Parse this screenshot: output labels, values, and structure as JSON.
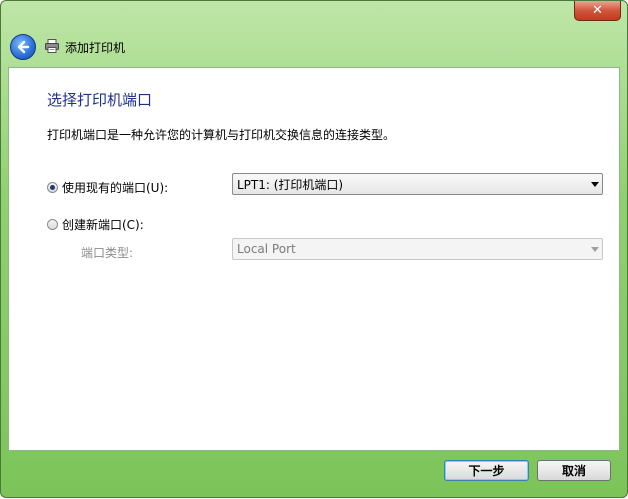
{
  "window": {
    "title": "添加打印机",
    "close_glyph": "✕"
  },
  "content": {
    "heading": "选择打印机端口",
    "description": "打印机端口是一种允许您的计算机与打印机交换信息的连接类型。",
    "use_existing": {
      "label": "使用现有的端口(U):",
      "checked": true,
      "selected_value": "LPT1: (打印机端口)"
    },
    "create_new": {
      "label": "创建新端口(C):",
      "checked": false,
      "port_type_label": "端口类型:",
      "port_type_value": "Local Port"
    }
  },
  "buttons": {
    "next": "下一步",
    "cancel": "取消"
  },
  "colors": {
    "frame": "#7cc45a",
    "heading": "#1e3287",
    "close": "#c33a1f",
    "back_button": "#2a6fd6"
  },
  "icons": {
    "back": "back-arrow-icon",
    "printer": "printer-icon",
    "close": "close-icon",
    "dropdown": "chevron-down-icon"
  }
}
